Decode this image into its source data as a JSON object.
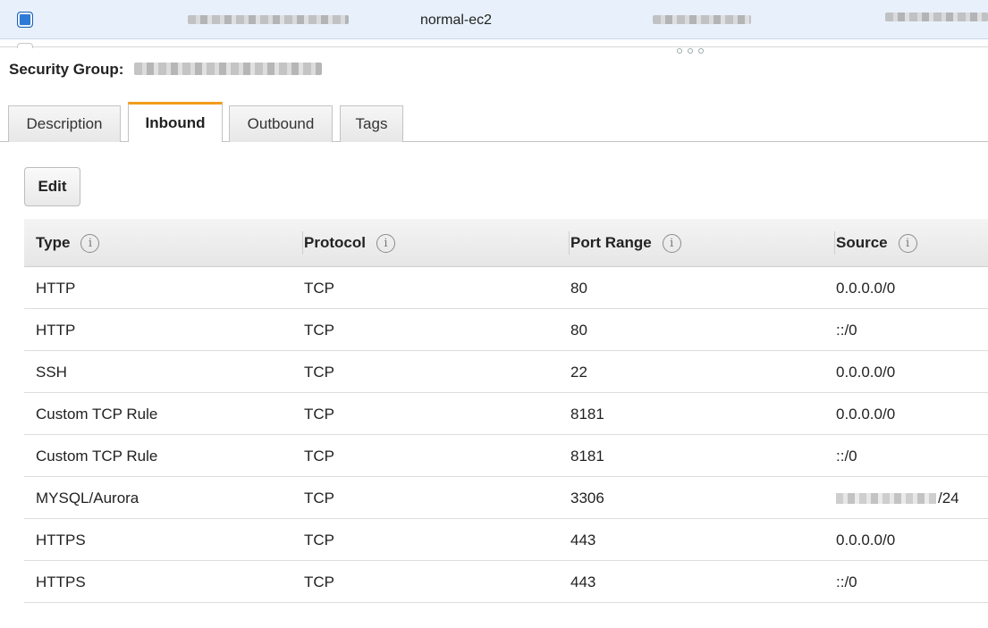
{
  "instance_row": {
    "name": "normal-ec2"
  },
  "security_group": {
    "label": "Security Group:"
  },
  "tabs": [
    {
      "label": "Description",
      "active": false
    },
    {
      "label": "Inbound",
      "active": true
    },
    {
      "label": "Outbound",
      "active": false
    },
    {
      "label": "Tags",
      "active": false
    }
  ],
  "edit_button": {
    "label": "Edit"
  },
  "table": {
    "headers": [
      "Type",
      "Protocol",
      "Port Range",
      "Source"
    ],
    "rows": [
      {
        "type": "HTTP",
        "protocol": "TCP",
        "port_range": "80",
        "source": "0.0.0.0/0"
      },
      {
        "type": "HTTP",
        "protocol": "TCP",
        "port_range": "80",
        "source": "::/0"
      },
      {
        "type": "SSH",
        "protocol": "TCP",
        "port_range": "22",
        "source": "0.0.0.0/0"
      },
      {
        "type": "Custom TCP Rule",
        "protocol": "TCP",
        "port_range": "8181",
        "source": "0.0.0.0/0"
      },
      {
        "type": "Custom TCP Rule",
        "protocol": "TCP",
        "port_range": "8181",
        "source": "::/0"
      },
      {
        "type": "MYSQL/Aurora",
        "protocol": "TCP",
        "port_range": "3306",
        "source": "/24"
      },
      {
        "type": "HTTPS",
        "protocol": "TCP",
        "port_range": "443",
        "source": "0.0.0.0/0"
      },
      {
        "type": "HTTPS",
        "protocol": "TCP",
        "port_range": "443",
        "source": "::/0"
      }
    ]
  },
  "colors": {
    "tab_accent": "#f29d1b",
    "selected_row": "#e8f1fb",
    "checkbox": "#2f7ad8"
  },
  "icons": {
    "info": "info-circle-icon",
    "checkbox": "checkbox-checked-icon"
  }
}
